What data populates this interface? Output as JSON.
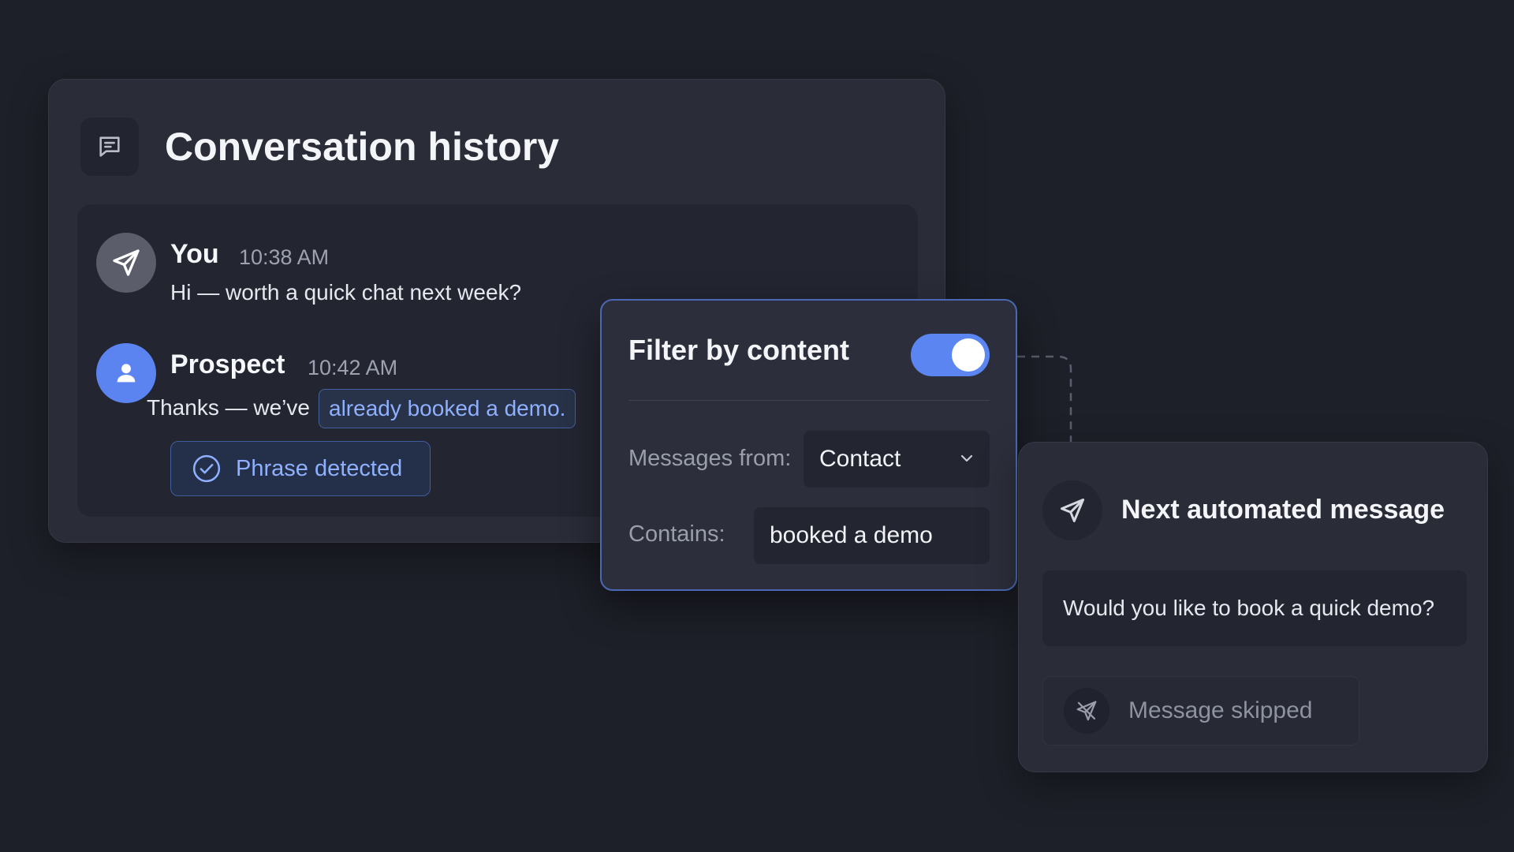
{
  "history": {
    "title": "Conversation history",
    "icon": "chat-icon",
    "messages": [
      {
        "sender": "You",
        "time": "10:38 AM",
        "text": "Hi — worth a quick chat next week?",
        "avatar_icon": "send-icon"
      },
      {
        "sender": "Prospect",
        "time": "10:42 AM",
        "text": "Thanks — we’ve",
        "highlight": "already booked a demo.",
        "avatar_icon": "user-icon"
      }
    ],
    "phrase_detected": "Phrase detected"
  },
  "filter": {
    "title": "Filter by content",
    "enabled": true,
    "messages_from_label": "Messages from:",
    "messages_from_value": "Contact",
    "contains_label": "Contains:",
    "contains_value": "booked a demo"
  },
  "next": {
    "title": "Next automated message",
    "message": "Would you like to book a quick demo?",
    "skipped_label": "Message skipped",
    "icon": "send-icon",
    "skipped_icon": "send-off-icon"
  },
  "colors": {
    "background": "#1e2029",
    "accent": "#5b86f2",
    "highlight_text": "#8fb0ff"
  }
}
